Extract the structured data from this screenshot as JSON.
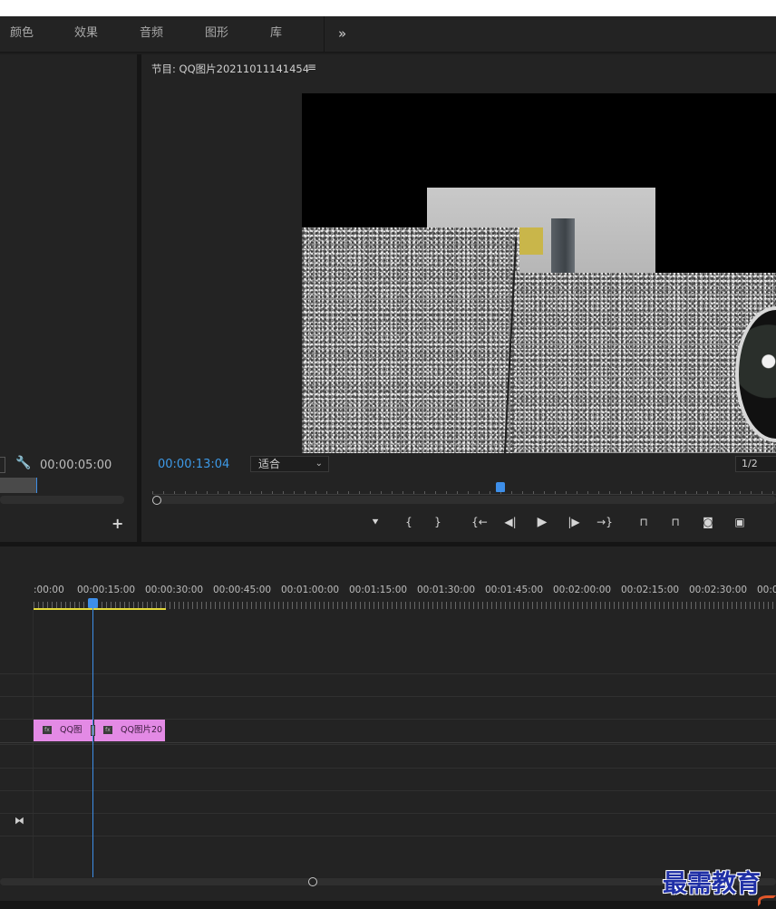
{
  "menu": {
    "items": [
      "颜色",
      "效果",
      "音频",
      "图形",
      "库"
    ],
    "more": "»"
  },
  "program_monitor": {
    "title": "节目: QQ图片20211011141454",
    "menu_icon": "≡",
    "timecode": "00:00:13:04",
    "fit": "适合",
    "resolution": "1/2"
  },
  "source_panel": {
    "timecode": "00:00:05:00",
    "add": "+"
  },
  "transport": {
    "marker": "marker-icon",
    "in": "{",
    "out": "}",
    "go_in": "{←",
    "step_back": "◀|",
    "play": "▶",
    "step_fwd": "|▶",
    "go_out": "→}"
  },
  "timeline": {
    "labels": [
      ":00:00",
      "00:00:15:00",
      "00:00:30:00",
      "00:00:45:00",
      "00:01:00:00",
      "00:01:15:00",
      "00:01:30:00",
      "00:01:45:00",
      "00:02:00:00",
      "00:02:15:00",
      "00:02:30:00",
      "00:0"
    ],
    "clips": [
      {
        "label": "QQ图",
        "fx": "fx"
      },
      {
        "label": "QQ图片20",
        "fx": "fx"
      }
    ]
  },
  "watermark": "最需教育",
  "colors": {
    "accent": "#3d9ae8",
    "clip": "#e38ae5",
    "workarea": "#e3d83a"
  }
}
